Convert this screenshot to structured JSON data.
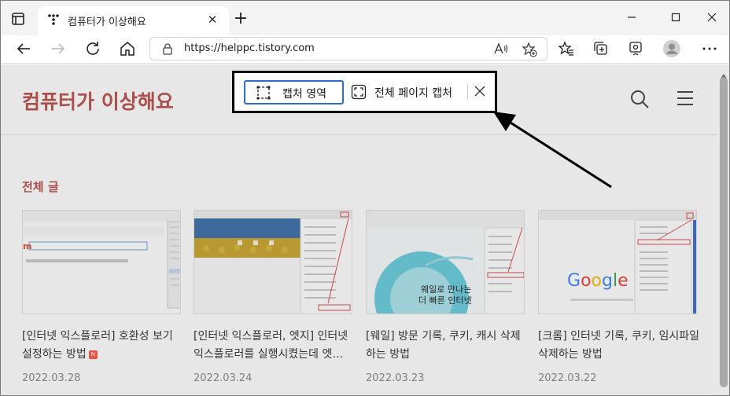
{
  "tab": {
    "title": "컴퓨터가 이상해요"
  },
  "address_bar": {
    "url": "https://helppc.tistory.com"
  },
  "site": {
    "title": "컴퓨터가 이상해요",
    "section_title": "전체 글",
    "accent_color": "#b8504b"
  },
  "posts": [
    {
      "title": "[인터넷 익스플로러] 호환성 보기 설정하는 방법",
      "date": "2022.03.28",
      "has_new_badge": true,
      "badge": "N"
    },
    {
      "title": "[인터넷 익스플로러, 엣지] 인터넷 익스플로러를 실행시켰는데 엣…",
      "date": "2022.03.24"
    },
    {
      "title": "[웨일] 방문 기록, 쿠키, 캐시 삭제하는 방법",
      "date": "2022.03.23"
    },
    {
      "title": "[크롬] 인터넷 기록, 쿠키, 임시파일 삭제하는 방법",
      "date": "2022.03.22"
    }
  ],
  "thumbnails": {
    "whale_text_line1": "웨일로 만나는",
    "whale_text_line2": "더 빠른 인터넷",
    "google_logo": "Google"
  },
  "capture_toolbar": {
    "area_label": "캡처 영역",
    "full_page_label": "전체 페이지 캡처"
  },
  "icons": {
    "tab_actions": "tab-actions-icon",
    "favicon": "tistory-favicon",
    "back": "arrow-left-icon",
    "forward": "arrow-right-icon",
    "refresh": "refresh-icon",
    "home": "home-icon",
    "lock": "lock-icon",
    "read_aloud": "read-aloud-icon",
    "add_favorite": "star-plus-icon",
    "favorites": "favorites-icon",
    "collections": "collections-icon",
    "capture": "web-capture-icon",
    "profile": "avatar-icon",
    "more": "ellipsis-icon"
  }
}
